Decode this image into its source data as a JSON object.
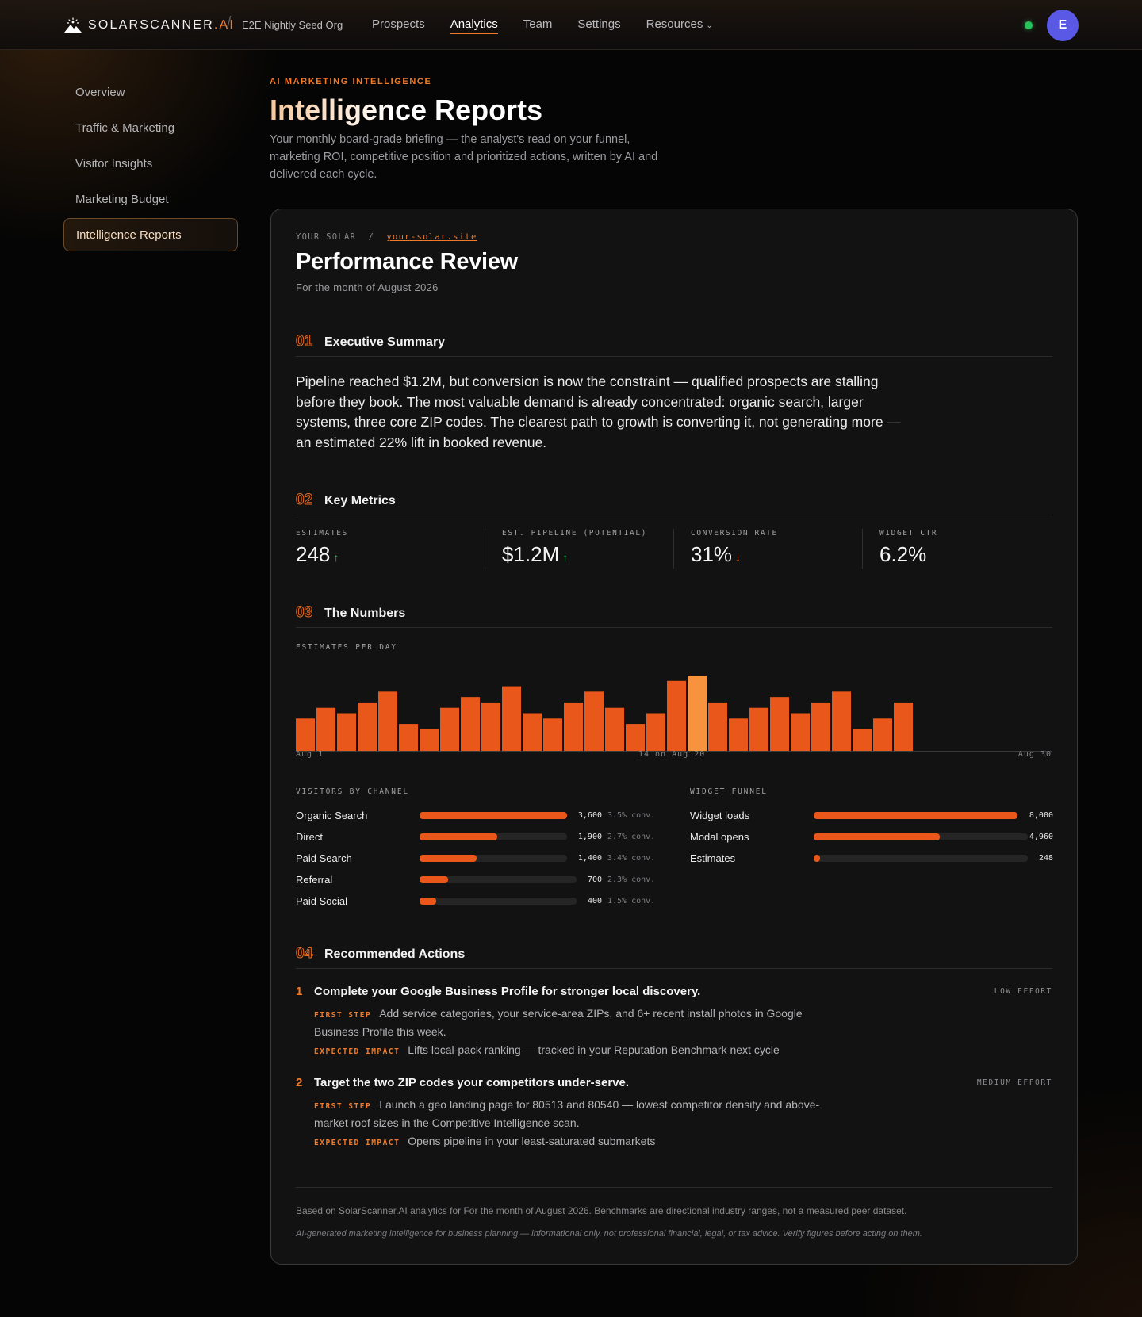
{
  "brand": {
    "name": "SOLARSCANNER",
    "suffix": ".AI"
  },
  "org": "E2E Nightly Seed Org",
  "nav": {
    "links": [
      {
        "label": "Prospects"
      },
      {
        "label": "Analytics"
      },
      {
        "label": "Team"
      },
      {
        "label": "Settings"
      },
      {
        "label": "Resources"
      }
    ],
    "active": "Analytics",
    "status": "online",
    "status_color": "#29c25a",
    "avatar_initial": "E",
    "avatar_color": "#5a59e6"
  },
  "sidebar": {
    "items": [
      {
        "label": "Overview"
      },
      {
        "label": "Traffic & Marketing"
      },
      {
        "label": "Visitor Insights"
      },
      {
        "label": "Marketing Budget"
      },
      {
        "label": "Intelligence Reports"
      }
    ],
    "active": "Intelligence Reports"
  },
  "header": {
    "eyebrow": "AI MARKETING INTELLIGENCE",
    "title": "Intelligence Reports",
    "subtitle": "Your monthly board-grade briefing — the analyst's read on your funnel, marketing ROI, competitive position and prioritized actions, written by AI and delivered each cycle."
  },
  "report": {
    "crumb_company": "YOUR SOLAR",
    "crumb_sep": "/",
    "crumb_site": "your-solar.site",
    "title": "Performance Review",
    "period": "For the month of August 2026",
    "sections": {
      "s1": {
        "num": "01",
        "title": "Executive Summary"
      },
      "s2": {
        "num": "02",
        "title": "Key Metrics"
      },
      "s3": {
        "num": "03",
        "title": "The Numbers"
      },
      "s4": {
        "num": "04",
        "title": "Recommended Actions"
      }
    },
    "summary": "Pipeline reached $1.2M, but conversion is now the constraint — qualified prospects are stalling before they book. The most valuable demand is already concentrated: organic search, larger systems, three core ZIP codes. The clearest path to growth is converting it, not generating more — an estimated 22% lift in booked revenue.",
    "metrics": [
      {
        "label": "ESTIMATES",
        "value": "248",
        "trend": "↑",
        "trend_dir": "up"
      },
      {
        "label": "EST. PIPELINE (POTENTIAL)",
        "value": "$1.2M",
        "trend": "↑",
        "trend_dir": "up"
      },
      {
        "label": "CONVERSION RATE",
        "value": "31%",
        "trend": "↓",
        "trend_dir": "down"
      },
      {
        "label": "WIDGET CTR",
        "value": "6.2%",
        "trend": "",
        "trend_dir": ""
      }
    ],
    "footer_note": "Based on SolarScanner.AI analytics for For the month of August 2026. Benchmarks are directional industry ranges, not a measured peer dataset.",
    "disclaimer": "AI-generated marketing intelligence for business planning — informational only, not professional financial, legal, or tax advice. Verify figures before acting on them."
  },
  "numbers": {
    "estimates_label": "ESTIMATES PER DAY",
    "axis_start": "Aug 1",
    "axis_peak": "14 on Aug 20",
    "axis_end": "Aug 30",
    "channels_label": "VISITORS BY CHANNEL",
    "channels": [
      {
        "name": "Organic Search",
        "value": "3,600",
        "conv": "3.5% conv."
      },
      {
        "name": "Direct",
        "value": "1,900",
        "conv": "2.7% conv."
      },
      {
        "name": "Paid Search",
        "value": "1,400",
        "conv": "3.4% conv."
      },
      {
        "name": "Referral",
        "value": "700",
        "conv": "2.3% conv."
      },
      {
        "name": "Paid Social",
        "value": "400",
        "conv": "1.5% conv."
      }
    ],
    "funnel_label": "WIDGET FUNNEL",
    "funnel": [
      {
        "name": "Widget loads",
        "value": "8,000"
      },
      {
        "name": "Modal opens",
        "value": "4,960"
      },
      {
        "name": "Estimates",
        "value": "248"
      }
    ]
  },
  "chart_data": {
    "type": "bar",
    "title": "ESTIMATES PER DAY",
    "xlabel": "",
    "ylabel": "",
    "categories": [
      "Aug 1",
      "Aug 2",
      "Aug 3",
      "Aug 4",
      "Aug 5",
      "Aug 6",
      "Aug 7",
      "Aug 8",
      "Aug 9",
      "Aug 10",
      "Aug 11",
      "Aug 12",
      "Aug 13",
      "Aug 14",
      "Aug 15",
      "Aug 16",
      "Aug 17",
      "Aug 18",
      "Aug 19",
      "Aug 20",
      "Aug 21",
      "Aug 22",
      "Aug 23",
      "Aug 24",
      "Aug 25",
      "Aug 26",
      "Aug 27",
      "Aug 28",
      "Aug 29",
      "Aug 30"
    ],
    "values": [
      6,
      8,
      7,
      9,
      11,
      5,
      4,
      8,
      10,
      9,
      12,
      7,
      6,
      9,
      11,
      8,
      5,
      7,
      13,
      14,
      9,
      6,
      8,
      10,
      7,
      9,
      11,
      4,
      6,
      9
    ],
    "highlight": "Aug 20",
    "ylim": [
      0,
      14
    ],
    "grid": false,
    "bar_color": "#e9581a",
    "highlight_color": "#f7923f"
  },
  "actions": [
    {
      "num": "1",
      "title": "Complete your Google Business Profile for stronger local discovery.",
      "effort": "LOW EFFORT",
      "first_step_tag": "FIRST STEP",
      "first_step": "Add service categories, your service-area ZIPs, and 6+ recent install photos in Google Business Profile this week.",
      "impact_tag": "EXPECTED IMPACT",
      "impact": "Lifts local-pack ranking — tracked in your Reputation Benchmark next cycle"
    },
    {
      "num": "2",
      "title": "Target the two ZIP codes your competitors under-serve.",
      "effort": "MEDIUM EFFORT",
      "first_step_tag": "FIRST STEP",
      "first_step": "Launch a geo landing page for 80513 and 80540 — lowest competitor density and above-market roof sizes in the Competitive Intelligence scan.",
      "impact_tag": "EXPECTED IMPACT",
      "impact": "Opens pipeline in your least-saturated submarkets"
    }
  ],
  "colors": {
    "accent": "#f07a2a",
    "bar": "#e9581a",
    "trend_up": "#32c774",
    "background": "#050505",
    "card": "#121212"
  }
}
